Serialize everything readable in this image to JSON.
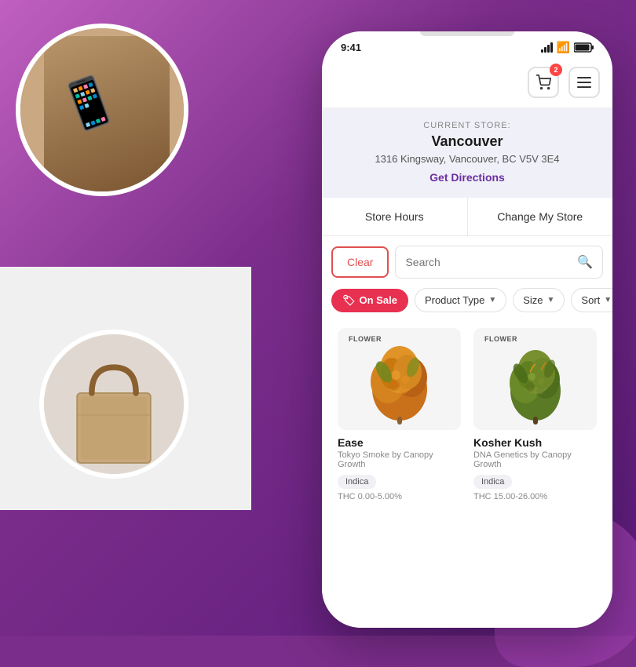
{
  "background": {
    "color_top": "#c060c0",
    "color_bottom": "#5a1a7a"
  },
  "status_bar": {
    "time": "9:41"
  },
  "header": {
    "cart_badge": "2",
    "cart_icon": "cart-icon",
    "menu_icon": "menu-icon"
  },
  "store": {
    "label": "CURRENT STORE:",
    "name": "Vancouver",
    "address": "1316 Kingsway, Vancouver, BC V5V 3E4",
    "directions_link": "Get Directions",
    "store_hours_btn": "Store Hours",
    "change_store_btn": "Change My Store"
  },
  "search": {
    "clear_btn": "Clear",
    "placeholder": "Search",
    "search_icon": "search-icon"
  },
  "filters": {
    "on_sale": "On Sale",
    "product_type": "Product Type",
    "size": "Size",
    "sort": "Sort"
  },
  "products": [
    {
      "badge": "FLOWER",
      "name": "Ease",
      "brand": "Tokyo Smoke by Canopy Growth",
      "type": "Indica",
      "thc": "THC 0.00-5.00%",
      "color": "orange"
    },
    {
      "badge": "FLOWER",
      "name": "Kosher Kush",
      "brand": "DNA Genetics by Canopy Growth",
      "type": "Indica",
      "thc": "THC 15.00-26.00%",
      "color": "green"
    }
  ]
}
